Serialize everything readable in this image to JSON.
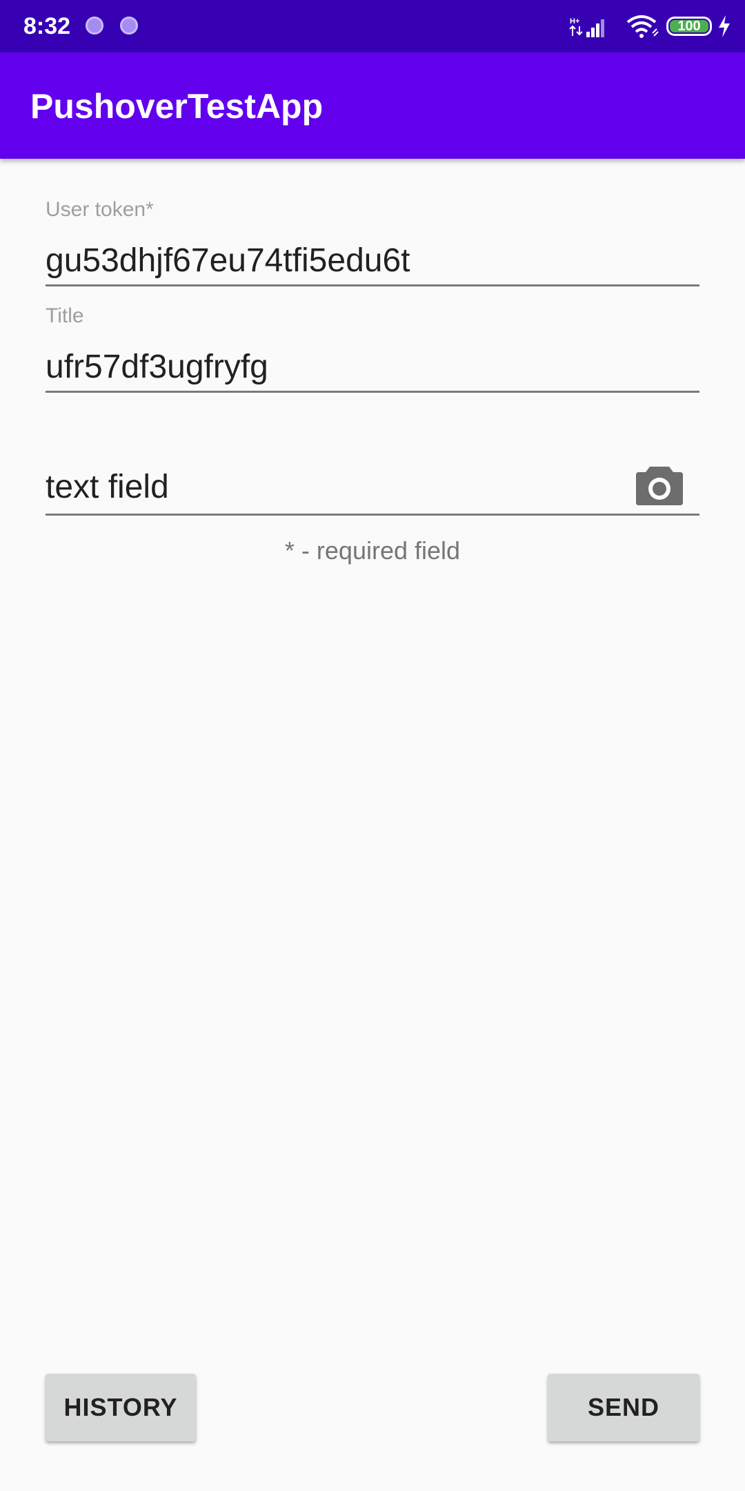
{
  "status_bar": {
    "time": "8:32",
    "battery": "100",
    "background": "#3700b3"
  },
  "app_bar": {
    "title": "PushoverTestApp",
    "background": "#6200ee"
  },
  "form": {
    "user_token": {
      "label": "User token*",
      "value": "gu53dhjf67eu74tfi5edu6t"
    },
    "title": {
      "label": "Title",
      "value": "ufr57df3ugfryfg"
    },
    "message": {
      "value": "text field",
      "icon": "camera-icon"
    },
    "hint": "* - required field"
  },
  "buttons": {
    "history": "HISTORY",
    "send": "SEND"
  }
}
